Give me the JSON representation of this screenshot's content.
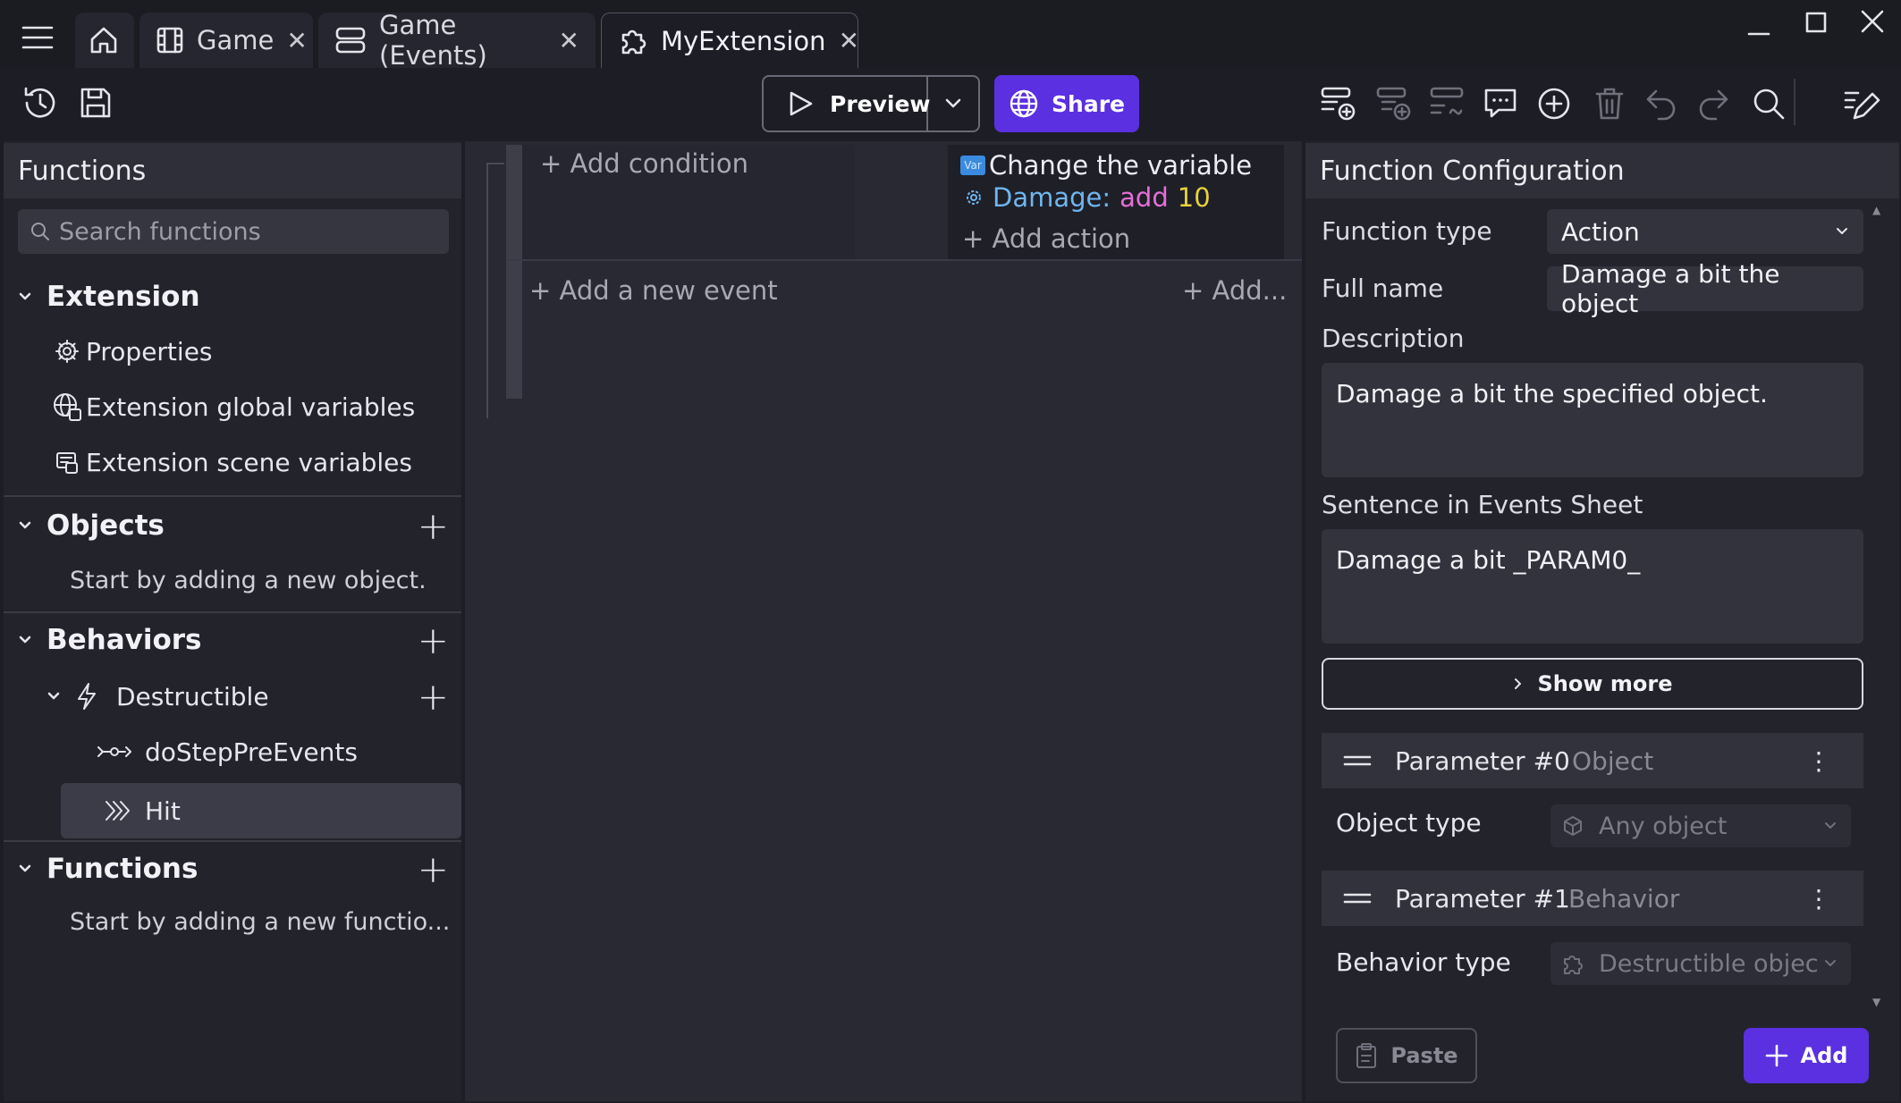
{
  "tabs": {
    "game": "Game",
    "game_events": "Game (Events)",
    "extension": "MyExtension"
  },
  "toolbar": {
    "preview": "Preview",
    "share": "Share"
  },
  "left": {
    "header": "Functions",
    "search_placeholder": "Search functions",
    "extension": {
      "title": "Extension",
      "properties": "Properties",
      "global_vars": "Extension global variables",
      "scene_vars": "Extension scene variables"
    },
    "objects": {
      "title": "Objects",
      "empty": "Start by adding a new object."
    },
    "behaviors": {
      "title": "Behaviors",
      "destructible": "Destructible",
      "do_step": "doStepPreEvents",
      "hit": "Hit"
    },
    "functions": {
      "title": "Functions",
      "empty": "Start by adding a new functio..."
    }
  },
  "events": {
    "add_condition": "+ Add condition",
    "action_title": "Change the variable",
    "var_name": "Damage",
    "colon": ":",
    "op": "add",
    "value": "10",
    "add_action": "+ Add action",
    "add_event": "+ Add a new event",
    "add_more": "+ Add..."
  },
  "config": {
    "header": "Function Configuration",
    "function_type_label": "Function type",
    "function_type_value": "Action",
    "full_name_label": "Full name",
    "full_name_value": "Damage a bit the object",
    "description_label": "Description",
    "description_value": "Damage a bit the specified object.",
    "sentence_label": "Sentence in Events Sheet",
    "sentence_value": "Damage a bit _PARAM0_",
    "show_more": "Show more",
    "param0": {
      "name": "Parameter #0",
      "type": "Object"
    },
    "object_type_label": "Object type",
    "object_type_value": "Any object",
    "param1": {
      "name": "Parameter #1",
      "type": "Behavior"
    },
    "behavior_type_label": "Behavior type",
    "behavior_type_value": "Destructible objec",
    "paste": "Paste",
    "add": "Add"
  },
  "colors": {
    "accent": "#5a30e0",
    "var_color": "#6fb6ef",
    "op_color": "#e66fd9",
    "value_color": "#e9d23a"
  }
}
